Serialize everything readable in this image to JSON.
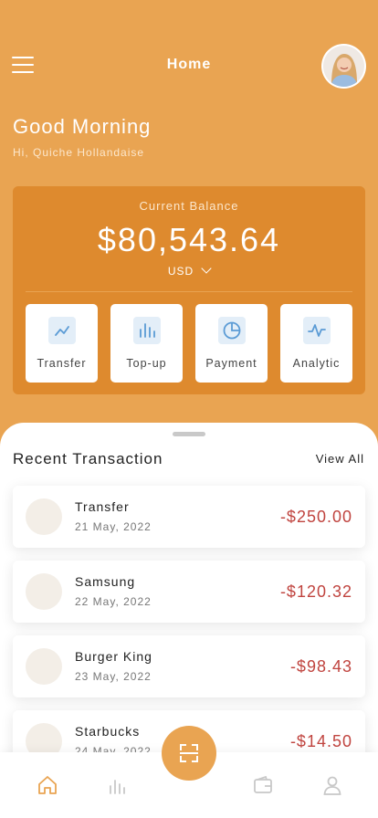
{
  "header": {
    "title": "Home"
  },
  "greeting": {
    "title": "Good Morning",
    "subtitle": "Hi, Quiche Hollandaise"
  },
  "balance": {
    "label": "Current Balance",
    "amount": "$80,543.64",
    "currency": "USD"
  },
  "actions": [
    {
      "label": "Transfer",
      "icon": "trend-line-icon"
    },
    {
      "label": "Top-up",
      "icon": "bar-chart-icon"
    },
    {
      "label": "Payment",
      "icon": "pie-chart-icon"
    },
    {
      "label": "Analytic",
      "icon": "pulse-icon"
    }
  ],
  "transactions": {
    "title": "Recent Transaction",
    "view_all": "View All",
    "items": [
      {
        "name": "Transfer",
        "date": "21 May, 2022",
        "amount": "-$250.00"
      },
      {
        "name": "Samsung",
        "date": "22 May, 2022",
        "amount": "-$120.32"
      },
      {
        "name": "Burger King",
        "date": "23 May, 2022",
        "amount": "-$98.43"
      },
      {
        "name": "Starbucks",
        "date": "24 May, 2022",
        "amount": "-$14.50"
      }
    ]
  },
  "tabbar": {
    "items": [
      "home-icon",
      "stats-icon",
      "scan-icon",
      "wallet-icon",
      "profile-icon"
    ]
  },
  "colors": {
    "primary": "#E9A452",
    "card": "#DE8A2E",
    "negative": "#C0443F",
    "icon_accent": "#5B9BD5"
  }
}
